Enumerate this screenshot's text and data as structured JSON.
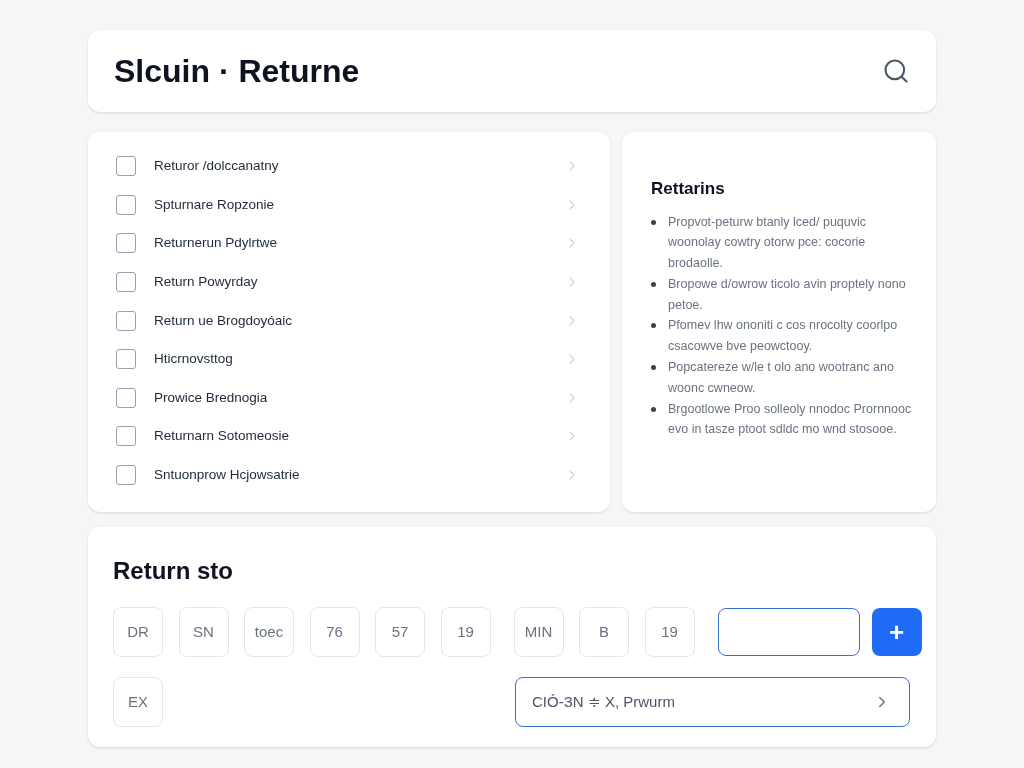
{
  "header": {
    "title": "Slcuin · Returne"
  },
  "checklist": [
    {
      "label": "Returor /dolccanatny",
      "checked": false
    },
    {
      "label": "Spturnare Ropzonie",
      "checked": false
    },
    {
      "label": "Returnerun Pdylrtwe",
      "checked": false
    },
    {
      "label": "Return Powyrday",
      "checked": false
    },
    {
      "label": "Return ue Brogdoyóaic",
      "checked": false
    },
    {
      "label": "Hticrnovsttog",
      "checked": false
    },
    {
      "label": "Prowice Brednogia",
      "checked": false
    },
    {
      "label": "Returnarn Sotomeosie",
      "checked": false
    },
    {
      "label": "Sntuonprow Hcjowsatrie",
      "checked": false
    }
  ],
  "notes": {
    "title": "Rettarins",
    "bullets": [
      "Propvot-peturw btanly lced/ puquvic woonolay cowtry otorw pce: cocorie brodaolle.",
      "Bropowe d/owrow ticolo avin proptely nono petoe.",
      "Pfomev lhw ononiti c cos nrocolty coorlpo csacowve bve peowctooy.",
      "Popcatereze w/le t olo ano wootranc ano woonc cwneow.",
      "Brgootlowe Proo solleoly nnodoc Prornnooc evo in tasze ptoot sdldc mo wnd stosooe."
    ]
  },
  "entry": {
    "title": "Return sto",
    "tile_groups": [
      [
        "DR",
        "SN",
        "toec",
        "76",
        "57",
        "19"
      ],
      [
        "MIN",
        "B",
        "19"
      ]
    ],
    "plus": "+",
    "extra_tile": "EX",
    "select_value": "CIÓ-ЗN ≑ X, Prwurm"
  }
}
